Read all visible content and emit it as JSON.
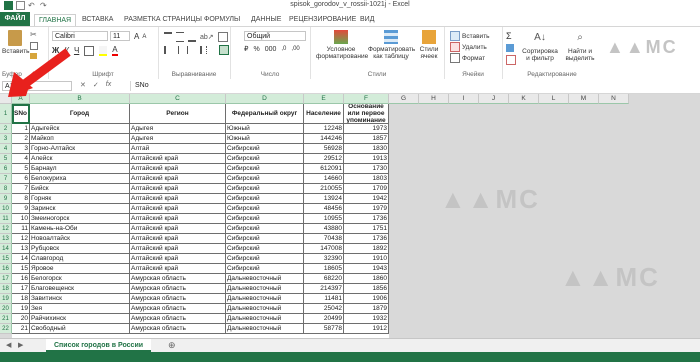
{
  "window": {
    "title": "spisok_gorodov_v_rossii-1021j - Excel"
  },
  "ribbon_tabs": [
    {
      "label": "ФАЙЛ"
    },
    {
      "label": "ГЛАВНАЯ"
    },
    {
      "label": "ВСТАВКА"
    },
    {
      "label": "РАЗМЕТКА СТРАНИЦЫ"
    },
    {
      "label": "ФОРМУЛЫ"
    },
    {
      "label": "ДАННЫЕ"
    },
    {
      "label": "РЕЦЕНЗИРОВАНИЕ"
    },
    {
      "label": "ВИД"
    }
  ],
  "ribbon": {
    "paste_label": "Вставить",
    "clipboard_label": "Буфер",
    "font_name": "Calibri",
    "font_size": "11",
    "font_group_label": "Шрифт",
    "align_group_label": "Выравнивание",
    "number_format": "Общий",
    "number_group_label": "Число",
    "cond_format_label": "Условное форматирование",
    "format_table_label": "Форматировать как таблицу",
    "cell_styles_label": "Стили ячеек",
    "styles_group_label": "Стили",
    "insert_label": "Вставить",
    "delete_label": "Удалить",
    "format_label": "Формат",
    "cells_group_label": "Ячейки",
    "sort_label": "Сортировка и фильтр",
    "find_label": "Найти и выделить",
    "editing_group_label": "Редактирование"
  },
  "formula_bar": {
    "name_box": "A1",
    "fx": "fx",
    "content": "SNo"
  },
  "columns": [
    "A",
    "B",
    "C",
    "D",
    "E",
    "F",
    "G",
    "H",
    "I",
    "J",
    "K",
    "L",
    "M",
    "N"
  ],
  "table": {
    "headers": [
      "SNo",
      "Город",
      "Регион",
      "Федеральный округ",
      "Население",
      "Основание или первое упоминание"
    ],
    "rows": [
      [
        "1",
        "Адыгейск",
        "Адыгея",
        "Южный",
        "12248",
        "1973"
      ],
      [
        "2",
        "Майкоп",
        "Адыгея",
        "Южный",
        "144246",
        "1857"
      ],
      [
        "3",
        "Горно-Алтайск",
        "Алтай",
        "Сибирский",
        "56928",
        "1830"
      ],
      [
        "4",
        "Алейск",
        "Алтайский край",
        "Сибирский",
        "29512",
        "1913"
      ],
      [
        "5",
        "Барнаул",
        "Алтайский край",
        "Сибирский",
        "612091",
        "1730"
      ],
      [
        "6",
        "Белокуриха",
        "Алтайский край",
        "Сибирский",
        "14660",
        "1803"
      ],
      [
        "7",
        "Бийск",
        "Алтайский край",
        "Сибирский",
        "210055",
        "1709"
      ],
      [
        "8",
        "Горняк",
        "Алтайский край",
        "Сибирский",
        "13924",
        "1942"
      ],
      [
        "9",
        "Заринск",
        "Алтайский край",
        "Сибирский",
        "48456",
        "1979"
      ],
      [
        "10",
        "Змеиногорск",
        "Алтайский край",
        "Сибирский",
        "10955",
        "1736"
      ],
      [
        "11",
        "Камень-на-Оби",
        "Алтайский край",
        "Сибирский",
        "43880",
        "1751"
      ],
      [
        "12",
        "Новоалтайск",
        "Алтайский край",
        "Сибирский",
        "70438",
        "1736"
      ],
      [
        "13",
        "Рубцовск",
        "Алтайский край",
        "Сибирский",
        "147008",
        "1892"
      ],
      [
        "14",
        "Славгород",
        "Алтайский край",
        "Сибирский",
        "32390",
        "1910"
      ],
      [
        "15",
        "Яровое",
        "Алтайский край",
        "Сибирский",
        "18605",
        "1943"
      ],
      [
        "16",
        "Белогорск",
        "Амурская область",
        "Дальневосточный",
        "68220",
        "1860"
      ],
      [
        "17",
        "Благовещенск",
        "Амурская область",
        "Дальневосточный",
        "214397",
        "1856"
      ],
      [
        "18",
        "Завитинск",
        "Амурская область",
        "Дальневосточный",
        "11481",
        "1906"
      ],
      [
        "19",
        "Зея",
        "Амурская область",
        "Дальневосточный",
        "25042",
        "1879"
      ],
      [
        "20",
        "Райчихинск",
        "Амурская область",
        "Дальневосточный",
        "20499",
        "1932"
      ],
      [
        "21",
        "Свободный",
        "Амурская область",
        "Дальневосточный",
        "58778",
        "1912"
      ]
    ]
  },
  "row_numbers": [
    "1",
    "2",
    "3",
    "4",
    "5",
    "6",
    "7",
    "8",
    "9",
    "10",
    "11",
    "12",
    "13",
    "14",
    "15",
    "16",
    "17",
    "18",
    "19",
    "20",
    "21",
    "22"
  ],
  "sheet_tab": "Список городов в России",
  "colors": {
    "accent": "#217346",
    "arrow": "#e8211d"
  }
}
